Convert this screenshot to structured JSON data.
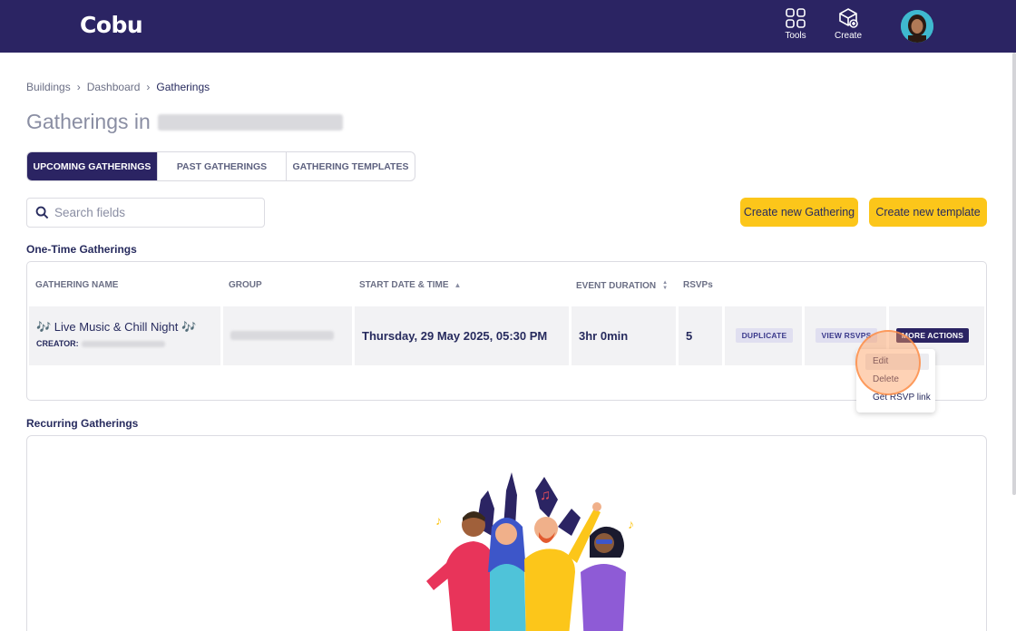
{
  "app": {
    "brand": "Cobu",
    "actions": [
      {
        "label": "Tools",
        "icon": "tools-grid-icon"
      },
      {
        "label": "Create",
        "icon": "create-cube-icon"
      }
    ],
    "user_avatar": "user-avatar"
  },
  "breadcrumb": [
    "Buildings",
    "Dashboard",
    "Gatherings"
  ],
  "page_title": "Gatherings in",
  "tabs": [
    {
      "label": "UPCOMING GATHERINGS",
      "active": true
    },
    {
      "label": "PAST GATHERINGS",
      "active": false
    },
    {
      "label": "GATHERING TEMPLATES",
      "active": false
    }
  ],
  "search": {
    "placeholder": "Search fields"
  },
  "buttons": {
    "create_gathering": "Create new Gathering",
    "create_template": "Create new template"
  },
  "sections": {
    "one_time": "One-Time Gatherings",
    "recurring": "Recurring Gatherings"
  },
  "table": {
    "columns": [
      "GATHERING NAME",
      "GROUP",
      "START DATE & TIME",
      "EVENT DURATION",
      "RSVPs"
    ],
    "rows": [
      {
        "name": "🎶 Live Music & Chill Night 🎶",
        "creator_label": "CREATOR:",
        "start": "Thursday, 29 May 2025, 05:30 PM",
        "duration": "3hr 0min",
        "rsvps": "5",
        "actions": [
          "DUPLICATE",
          "VIEW RSVPS",
          "MORE ACTIONS"
        ]
      }
    ]
  },
  "dropdown": [
    "Edit",
    "Delete",
    "Get RSVP link"
  ],
  "colors": {
    "nav_bg": "#2b2463",
    "accent_yellow": "#fcc61a",
    "text_primary": "#272b5e"
  }
}
